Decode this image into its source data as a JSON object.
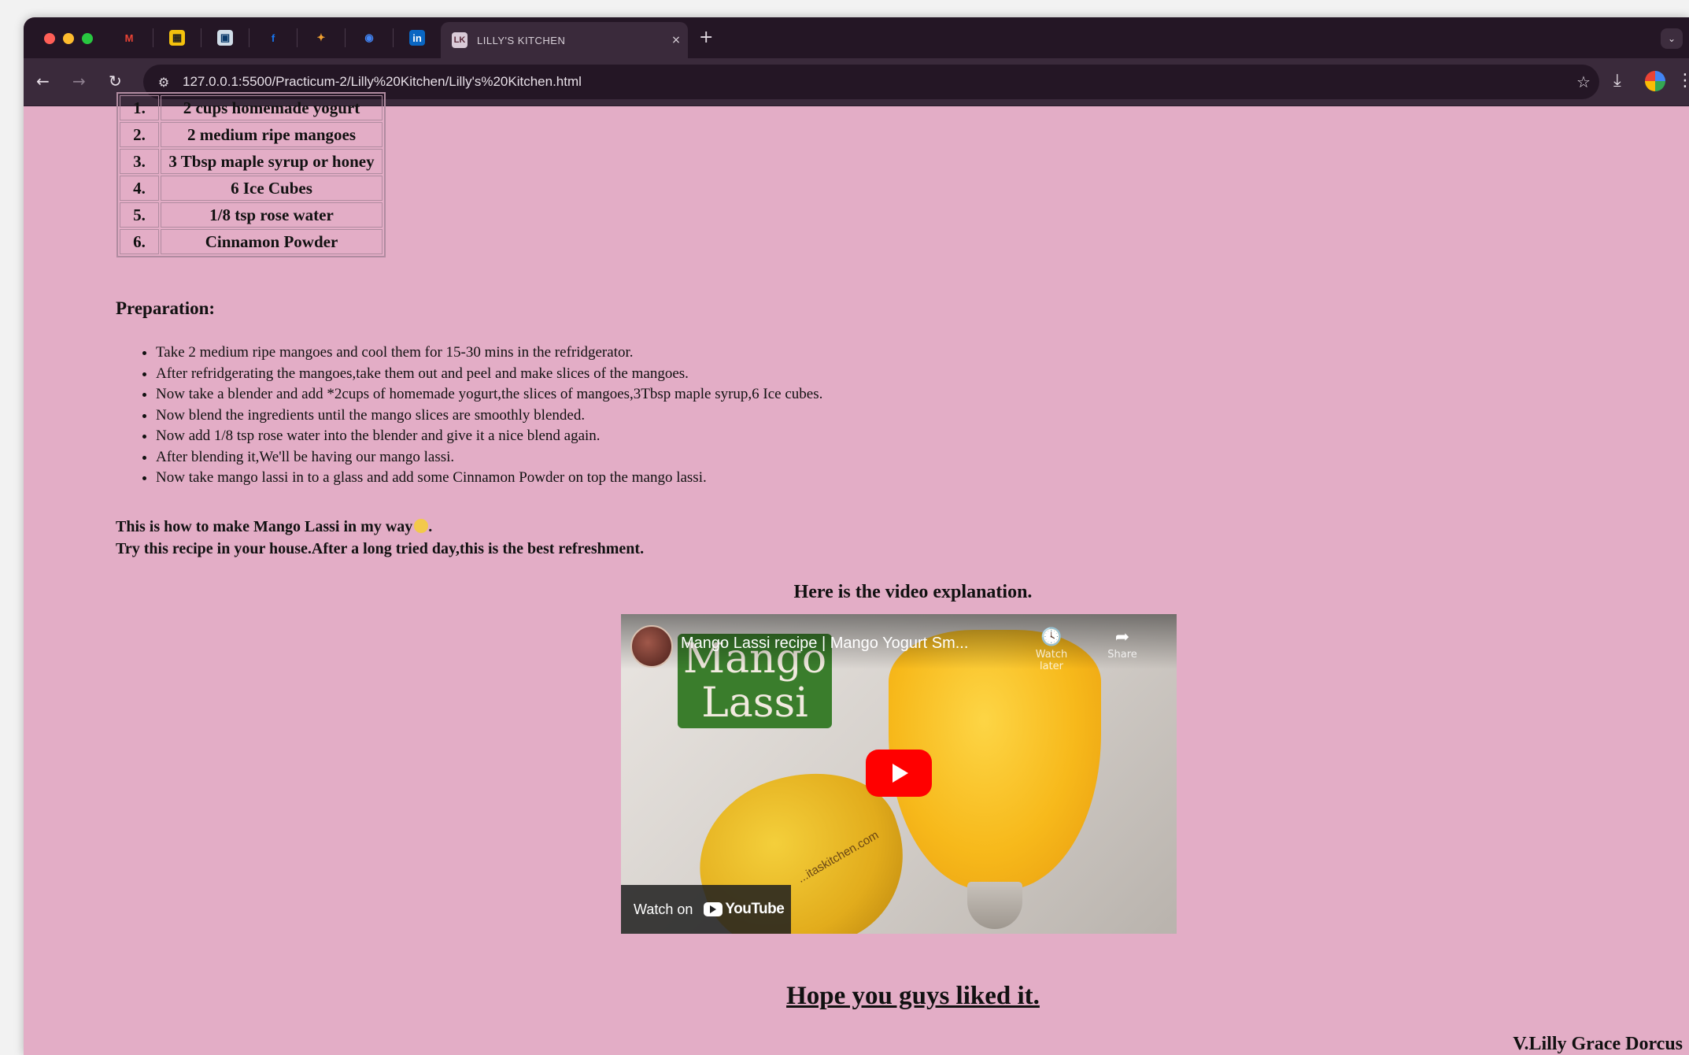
{
  "browser": {
    "pinned_tabs": [
      {
        "icon": "gmail-icon",
        "glyph": "M",
        "color": "#ea4335",
        "bg": "transparent"
      },
      {
        "icon": "sheets-icon",
        "glyph": "▦",
        "color": "#1f1f1f",
        "bg": "#f4c20d"
      },
      {
        "icon": "outlook-icon",
        "glyph": "▣",
        "color": "#0a3a6a",
        "bg": "#d0dde8"
      },
      {
        "icon": "facebook-icon",
        "glyph": "f",
        "color": "#1877f2",
        "bg": "transparent"
      },
      {
        "icon": "photos-icon",
        "glyph": "✦",
        "color": "#f0a030",
        "bg": "transparent"
      },
      {
        "icon": "chrome-icon",
        "glyph": "◉",
        "color": "#4285f4",
        "bg": "transparent"
      },
      {
        "icon": "linkedin-icon",
        "glyph": "in",
        "color": "#ffffff",
        "bg": "#0a66c2"
      }
    ],
    "active_tab": {
      "favicon": "LK",
      "title": "LILLY'S KITCHEN",
      "close": "×"
    },
    "new_tab": "+",
    "tab_menu": "⌄",
    "nav": {
      "back": "←",
      "forward": "→",
      "reload": "↻"
    },
    "site_info": "⚙",
    "url": "127.0.0.1:5500/Practicum-2/Lilly%20Kitchen/Lilly's%20Kitchen.html",
    "bookmark": "☆",
    "download": "⤓",
    "menu": "⋮"
  },
  "ingredients": [
    {
      "num": "1.",
      "item": "2 cups homemade yogurt"
    },
    {
      "num": "2.",
      "item": "2 medium ripe mangoes"
    },
    {
      "num": "3.",
      "item": "3 Tbsp maple syrup or honey"
    },
    {
      "num": "4.",
      "item": "6 Ice Cubes"
    },
    {
      "num": "5.",
      "item": "1/8 tsp rose water"
    },
    {
      "num": "6.",
      "item": "Cinnamon Powder"
    }
  ],
  "preparation": {
    "title": "Preparation:",
    "steps": [
      "Take 2 medium ripe mangoes and cool them for 15-30 mins in the refridgerator.",
      "After refridgerating the mangoes,take them out and peel and make slices of the mangoes.",
      "Now take a blender and add *2cups of homemade yogurt,the slices of mangoes,3Tbsp maple syrup,6 Ice cubes.",
      "Now blend the ingredients until the mango slices are smoothly blended.",
      "Now add 1/8 tsp rose water into the blender and give it a nice blend again.",
      "After blending it,We'll be having our mango lassi.",
      "Now take mango lassi in to a glass and add some Cinnamon Powder on top the mango lassi."
    ]
  },
  "closing": {
    "line1": "This is how to make Mango Lassi in my way",
    "line1_end": ".",
    "line2": "Try this recipe in your house.After a long tried day,this is the best refreshment."
  },
  "video": {
    "heading": "Here is the video explanation.",
    "title": "Mango Lassi recipe | Mango Yogurt Sm...",
    "thumbnail_text_1": "Mango",
    "thumbnail_text_2": "Lassi",
    "watermark": "...itaskitchen.com",
    "watch_later_icon": "🕓",
    "watch_later_label": "Watch later",
    "share_icon": "➦",
    "share_label": "Share",
    "watch_on": "Watch on",
    "platform": "YouTube"
  },
  "footer": {
    "hope": "Hope you guys liked it.",
    "author": "V.Lilly Grace Dorcus"
  }
}
